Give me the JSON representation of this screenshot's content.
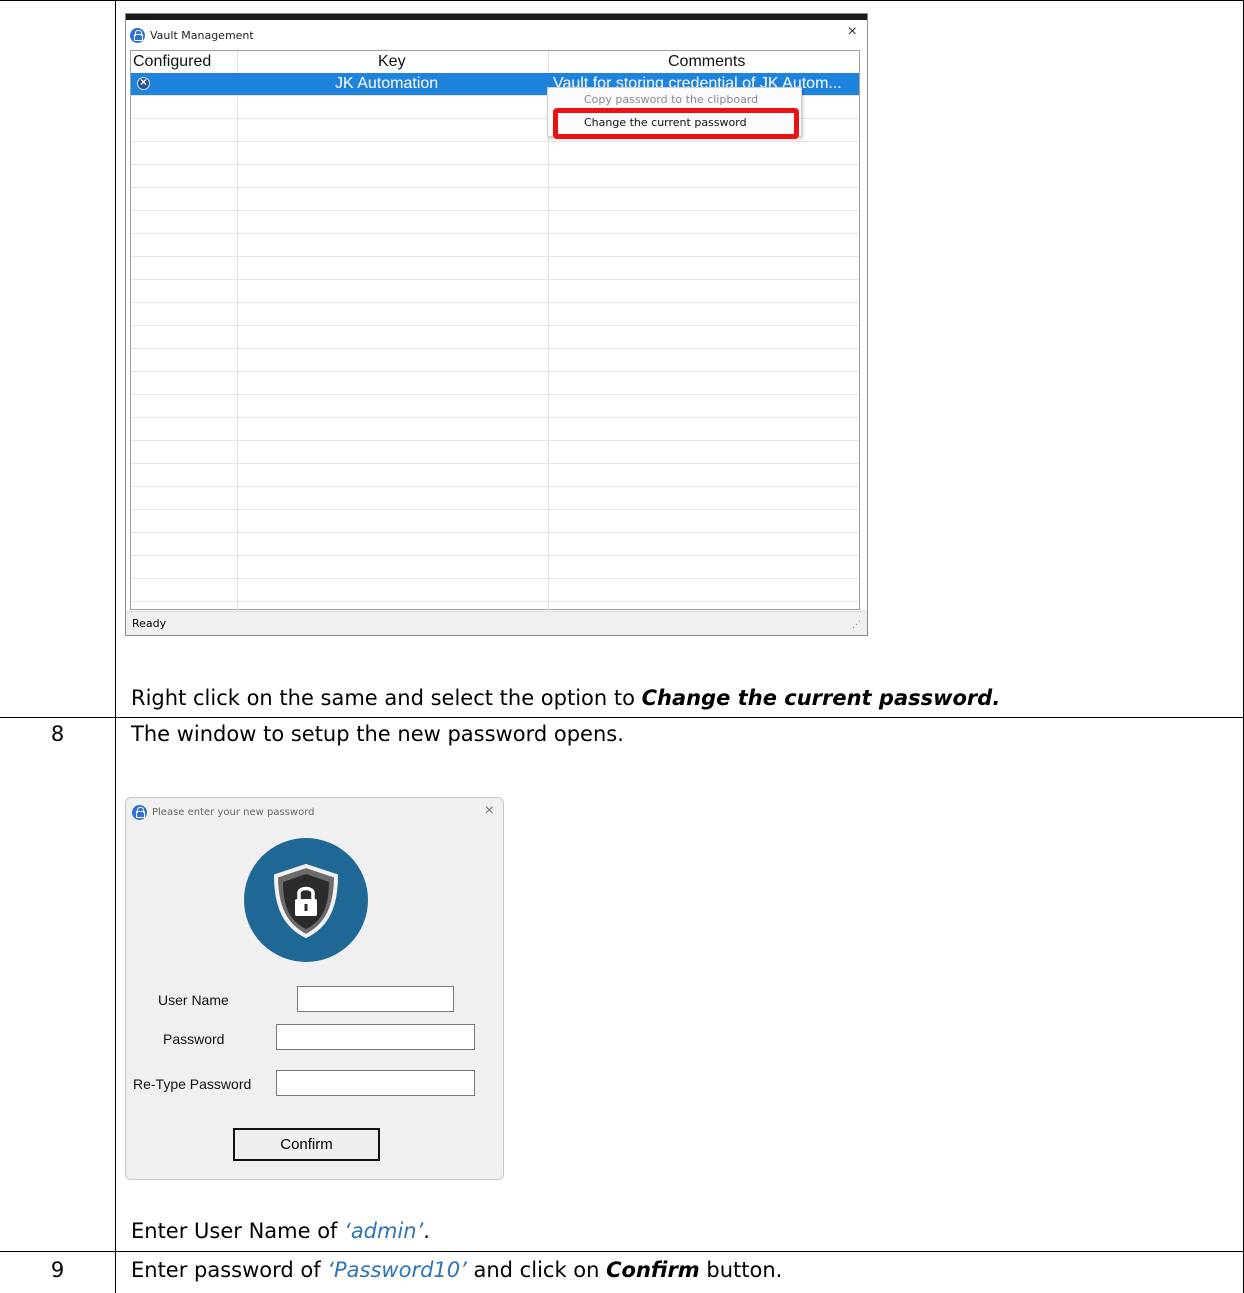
{
  "vault_window": {
    "title": "Vault Management",
    "close_glyph": "×",
    "columns": [
      "Configured",
      "Key",
      "Comments"
    ],
    "row": {
      "status_icon": "x-circle-icon",
      "key": "JK Automation",
      "comment": "Vault for storing credential of JK Autom..."
    },
    "context_menu": {
      "copy_label": "Copy password to the clipboard",
      "change_label": "Change the current password"
    },
    "status": "Ready",
    "highlight_color": "#ee1111",
    "selection_color": "#1e83dc"
  },
  "step7": {
    "text_before": "Right click on the same and select the option to ",
    "text_emph": "Change the current password."
  },
  "step8": {
    "number": "8",
    "intro": "The window to setup the new password opens.",
    "after_before": "Enter User Name of ",
    "after_value": "‘admin’",
    "after_end": "."
  },
  "password_dialog": {
    "title": "Please enter your new password",
    "close_glyph": "×",
    "user_label": "User Name",
    "password_label": "Password",
    "retype_label": "Re-Type Password",
    "confirm_label": "Confirm",
    "badge_color": "#1f6895",
    "badge_icon": "shield-lock-icon"
  },
  "step9": {
    "number": "9",
    "text_a": "Enter password of ",
    "value": "‘Password10’",
    "text_b": " and click on ",
    "emph": "Confirm",
    "text_c": " button."
  },
  "accent_blue": "#2e74b5"
}
